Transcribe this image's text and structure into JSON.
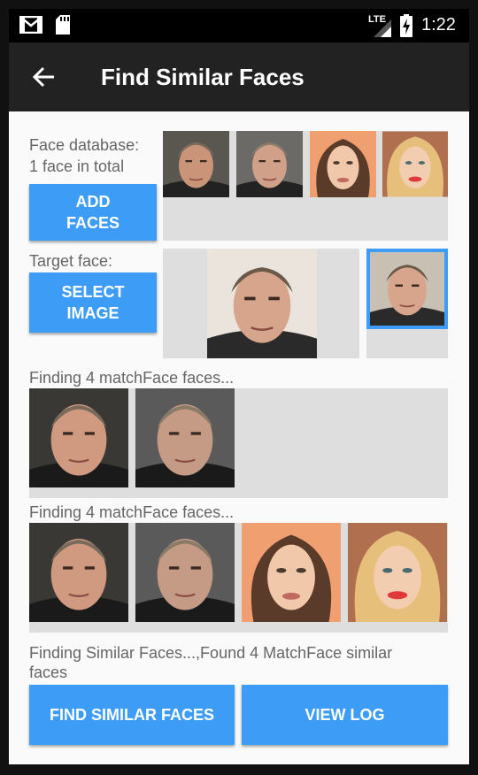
{
  "status": {
    "network": "LTE",
    "time": "1:22",
    "icons": [
      "gmail-icon",
      "sd-card-icon",
      "signal-icon",
      "battery-charging-icon"
    ]
  },
  "appbar": {
    "title": "Find Similar Faces",
    "back_icon": "arrow-back-icon"
  },
  "database": {
    "label": "Face database:",
    "count": "1 face in total",
    "add_button": "ADD FACES",
    "faces": [
      "man-portrait-1",
      "man-portrait-2",
      "woman-portrait-1",
      "woman-portrait-2"
    ]
  },
  "target": {
    "label": "Target face:",
    "select_button": "SELECT IMAGE",
    "image": "man-portrait-large",
    "detected_face": "man-portrait-crop"
  },
  "result1": {
    "label": "Finding 4 matchFace faces...",
    "faces": [
      "man-portrait-1",
      "man-portrait-2"
    ]
  },
  "result2": {
    "label": "Finding 4 matchFace faces...",
    "faces": [
      "man-portrait-1",
      "man-portrait-2",
      "woman-portrait-1",
      "woman-portrait-2"
    ]
  },
  "status_text": "Finding Similar Faces...,Found 4 MatchFace similar faces",
  "buttons": {
    "find": "FIND SIMILAR FACES",
    "view_log": "VIEW LOG"
  },
  "colors": {
    "accent": "#3d9cf5",
    "appbar": "#222222",
    "placeholder": "#dedede"
  }
}
